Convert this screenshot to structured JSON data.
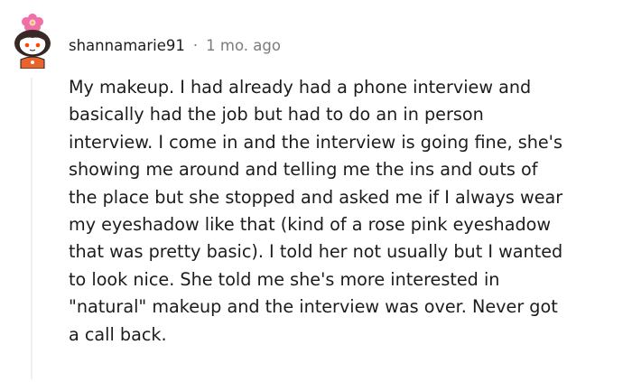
{
  "comment": {
    "username": "shannamarie91",
    "separator": "·",
    "time": "1 mo. ago",
    "avatar_icon": "snoo-avatar-with-flower-icon",
    "body_lines": [
      "My makeup. I had already had a phone interview and",
      "basically had the job but had to do an in person",
      "interview. I come in and the interview is going fine, she's",
      "showing me around and telling me the ins and outs of",
      "the place but she stopped and asked me if I always wear",
      "my eyeshadow like that (kind of a rose pink eyeshadow",
      "that was pretty basic). I told her not usually but I wanted",
      "to look nice. She told me she's more interested in",
      "\"natural\" makeup and the interview was over. Never got",
      "a call back."
    ]
  },
  "colors": {
    "text": "#1c1c1c",
    "meta": "#7c7c7c",
    "thread_line": "#edeff1",
    "flower": "#f06fa5",
    "shirt": "#e8642c"
  }
}
